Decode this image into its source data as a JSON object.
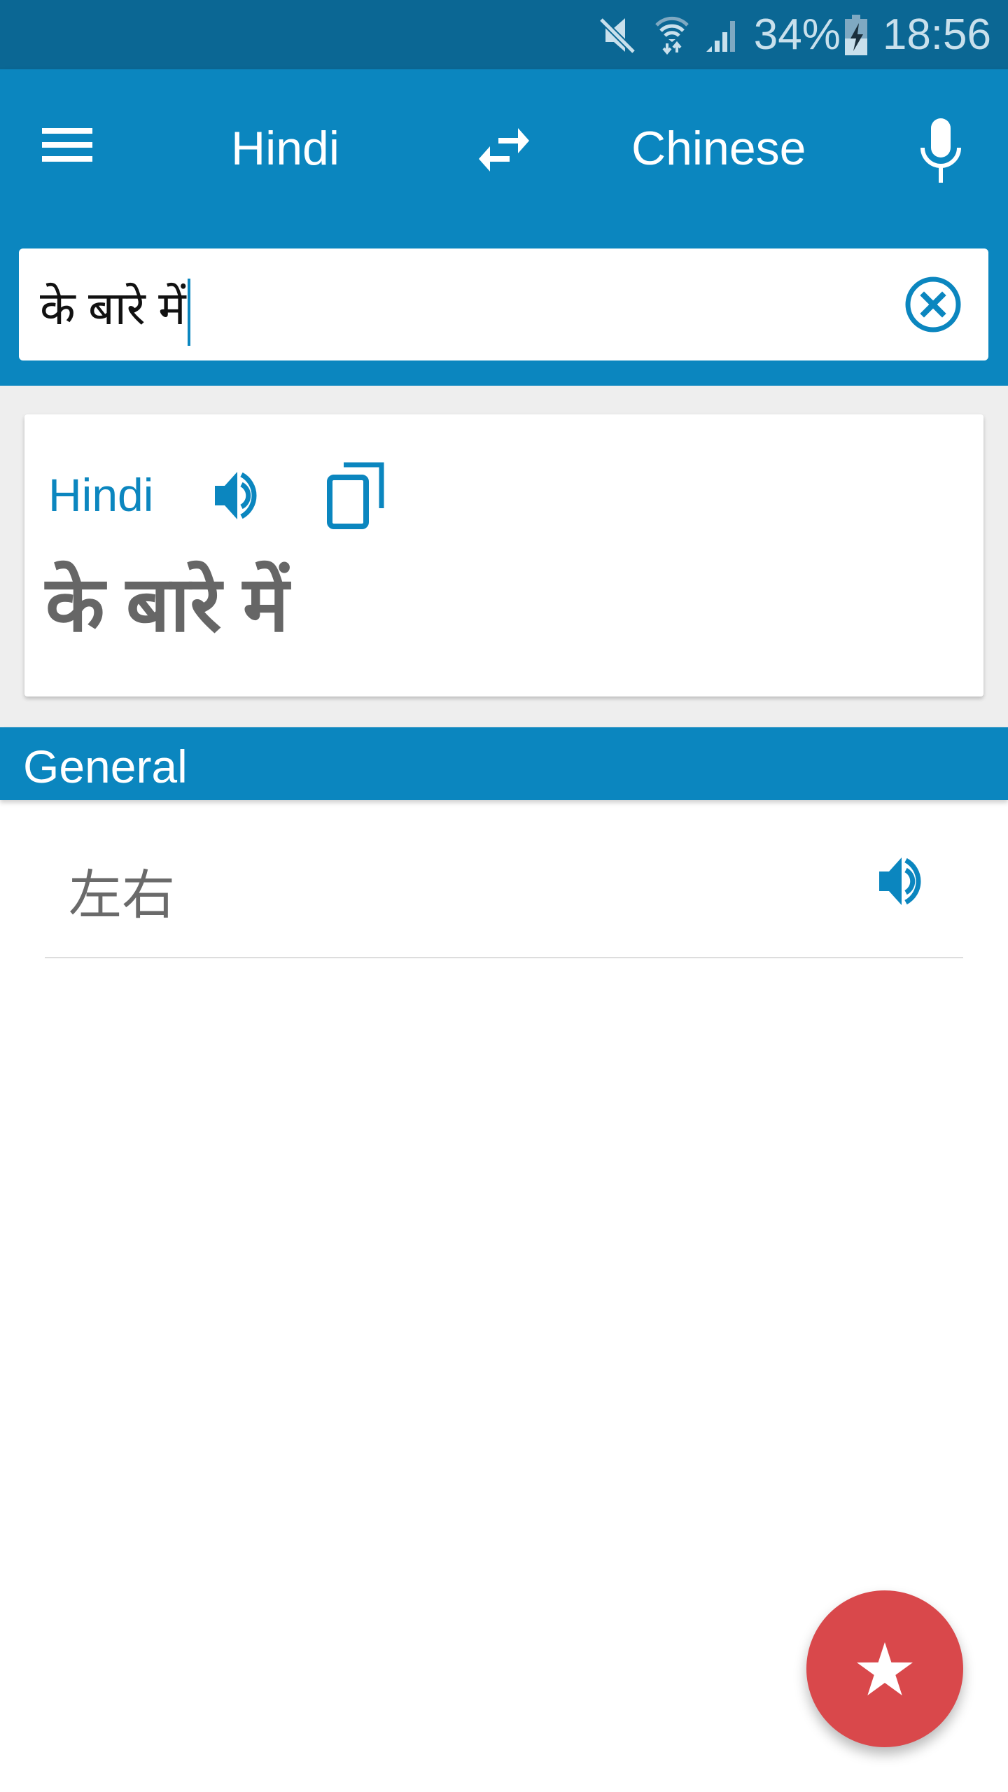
{
  "status_bar": {
    "battery_percent": "34%",
    "time": "18:56",
    "icons": [
      "mute-icon",
      "wifi-icon",
      "signal-icon",
      "battery-charging-icon"
    ]
  },
  "toolbar": {
    "menu_icon": "menu-icon",
    "source_language": "Hindi",
    "swap_icon": "swap-icon",
    "target_language": "Chinese",
    "mic_icon": "microphone-icon"
  },
  "input": {
    "value": "के बारे में",
    "clear_icon": "clear-icon"
  },
  "source_card": {
    "language": "Hindi",
    "speak_icon": "speaker-icon",
    "copy_icon": "copy-icon",
    "text": "के बारे में"
  },
  "section": {
    "title": "General"
  },
  "results": [
    {
      "text": "左右",
      "speak_icon": "speaker-icon"
    }
  ],
  "fab": {
    "icon": "star-icon"
  },
  "colors": {
    "status_bar": "#0b6794",
    "primary": "#0b86bf",
    "fab": "#d9484b",
    "background": "#eeeeee",
    "source_text": "#666666",
    "result_text": "#6a6a6a"
  }
}
